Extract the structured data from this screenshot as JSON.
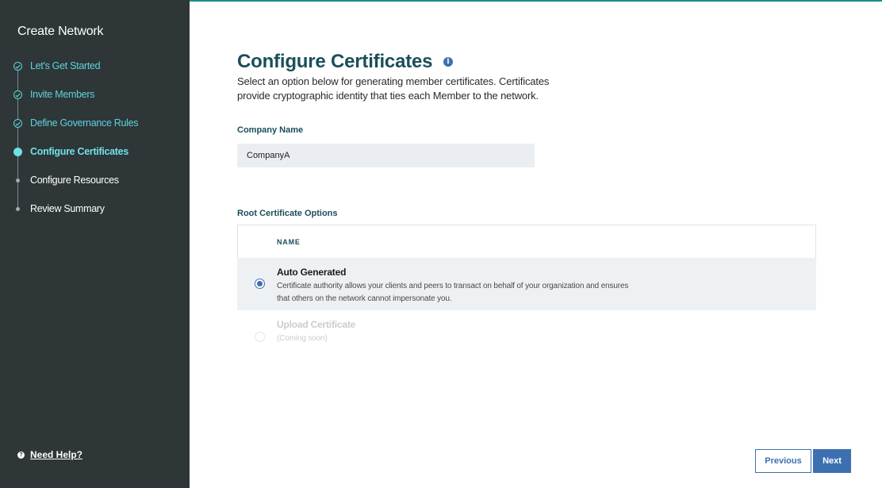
{
  "sidebar": {
    "title": "Create Network",
    "steps": [
      {
        "label": "Let's Get Started",
        "state": "done"
      },
      {
        "label": "Invite Members",
        "state": "done"
      },
      {
        "label": "Define Governance Rules",
        "state": "done"
      },
      {
        "label": "Configure Certificates",
        "state": "current"
      },
      {
        "label": "Configure Resources",
        "state": "pending"
      },
      {
        "label": "Review Summary",
        "state": "pending"
      }
    ],
    "help": {
      "icon": "?",
      "label": "Need Help?"
    }
  },
  "main": {
    "title": "Configure Certificates",
    "info_icon": "i",
    "description": "Select an option below for generating member certificates. Certificates provide cryptographic identity that ties each Member to the network.",
    "company_name": {
      "label": "Company Name",
      "value": "CompanyA"
    },
    "root_options": {
      "label": "Root Certificate Options",
      "column_header": "NAME",
      "options": [
        {
          "title": "Auto Generated",
          "description": "Certificate authority allows your clients and peers to transact on behalf of your organization and ensures that others on the network cannot impersonate you.",
          "selected": true,
          "disabled": false
        },
        {
          "title": "Upload Certificate",
          "description": "(Coming soon)",
          "selected": false,
          "disabled": true
        }
      ]
    },
    "buttons": {
      "previous": "Previous",
      "next": "Next"
    }
  },
  "colors": {
    "sidebar_bg": "#2e3638",
    "accent_teal": "#5ed3d9",
    "heading": "#1a4f5a",
    "primary_blue": "#3d70b2"
  }
}
